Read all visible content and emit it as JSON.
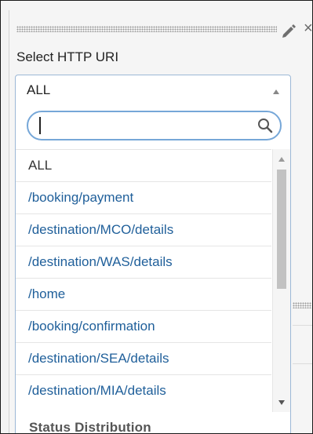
{
  "widget": {
    "label": "Select HTTP URI",
    "close_symbol": "×",
    "behind_text": "Status Distribution"
  },
  "select": {
    "value": "ALL",
    "search_placeholder": "",
    "options": [
      "ALL",
      "/booking/payment",
      "/destination/MCO/details",
      "/destination/WAS/details",
      "/home",
      "/booking/confirmation",
      "/destination/SEA/details",
      "/destination/MIA/details"
    ]
  },
  "icons": {
    "edit": "pencil-icon",
    "close": "close-icon",
    "search": "search-icon",
    "select_arrow": "chevron-up-icon",
    "scroll_up": "scroll-up-arrow-icon",
    "scroll_down": "scroll-down-arrow-icon"
  },
  "colors": {
    "link": "#1f5f9a",
    "focus_border": "#76a7d8",
    "select_border": "#9cb8d6",
    "scroll_thumb": "#c2c2c2"
  }
}
